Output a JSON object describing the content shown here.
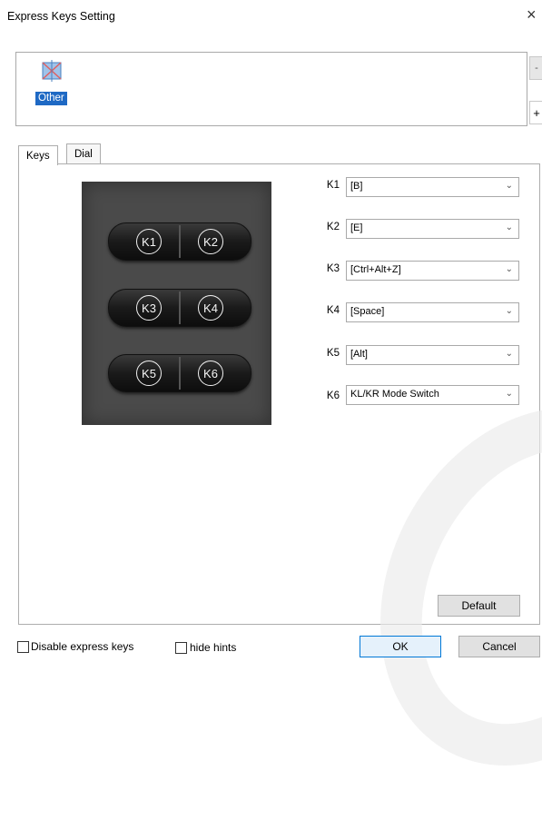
{
  "window": {
    "title": "Express Keys Setting",
    "close_glyph": "×"
  },
  "app_list": {
    "items": [
      {
        "label": "Other",
        "icon": "other-app-icon"
      }
    ],
    "minus_label": "-",
    "plus_label": "+"
  },
  "tabs": [
    {
      "label": "Keys",
      "active": true
    },
    {
      "label": "Dial",
      "active": false
    }
  ],
  "device": {
    "key_labels": [
      "K1",
      "K2",
      "K3",
      "K4",
      "K5",
      "K6"
    ]
  },
  "keys": [
    {
      "label": "K1",
      "value": "[B]"
    },
    {
      "label": "K2",
      "value": "[E]"
    },
    {
      "label": "K3",
      "value": "[Ctrl+Alt+Z]"
    },
    {
      "label": "K4",
      "value": "[Space]"
    },
    {
      "label": "K5",
      "value": "[Alt]"
    },
    {
      "label": "K6",
      "value": "KL/KR Mode Switch"
    }
  ],
  "buttons": {
    "default": "Default",
    "ok": "OK",
    "cancel": "Cancel"
  },
  "checkboxes": {
    "disable_express_keys": {
      "label": "Disable express keys",
      "checked": false
    },
    "hide_hints": {
      "label": "hide hints",
      "checked": false
    }
  },
  "colors": {
    "selection": "#1e69c4",
    "device_bg": "#4a4a4a",
    "ok_border": "#0078d7"
  }
}
